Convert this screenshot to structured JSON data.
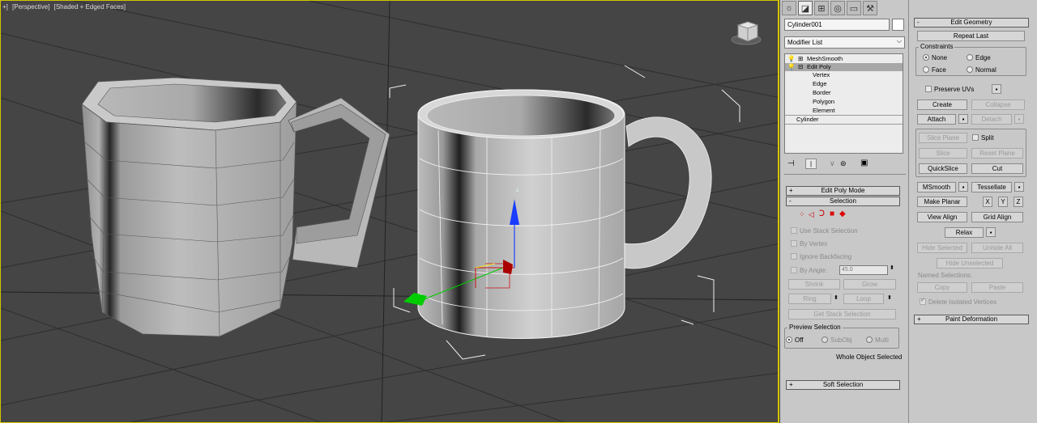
{
  "viewport": {
    "labels": [
      "+]",
      "[Perspective]",
      "[Shaded + Edged Faces]"
    ]
  },
  "command_panel": {
    "object_name": "Cylinder001",
    "modifier_list": "Modifier List",
    "stack": {
      "items": [
        {
          "label": "MeshSmooth",
          "indent": 0,
          "selected": false
        },
        {
          "label": "Edit Poly",
          "indent": 0,
          "selected": true
        },
        {
          "label": "Vertex",
          "indent": 1,
          "selected": false
        },
        {
          "label": "Edge",
          "indent": 1,
          "selected": false
        },
        {
          "label": "Border",
          "indent": 1,
          "selected": false
        },
        {
          "label": "Polygon",
          "indent": 1,
          "selected": false
        },
        {
          "label": "Element",
          "indent": 1,
          "selected": false
        },
        {
          "label": "Cylinder",
          "indent": 0,
          "selected": false
        }
      ]
    },
    "edit_poly_mode": "Edit Poly Mode",
    "selection": {
      "title": "Selection",
      "use_stack_selection": "Use Stack Selection",
      "by_vertex": "By Vertex",
      "ignore_backfacing": "Ignore Backfacing",
      "by_angle": "By Angle:",
      "angle_value": "45.0",
      "shrink": "Shrink",
      "grow": "Grow",
      "ring": "Ring",
      "loop": "Loop",
      "get_stack_selection": "Get Stack Selection",
      "preview_selection": "Preview Selection",
      "off": "Off",
      "subobj": "SubObj",
      "multi": "Multi",
      "status": "Whole Object Selected"
    },
    "soft_selection": "Soft Selection"
  },
  "edit_geometry": {
    "title": "Edit Geometry",
    "repeat_last": "Repeat Last",
    "constraints": "Constraints",
    "none": "None",
    "edge": "Edge",
    "face": "Face",
    "normal": "Normal",
    "preserve_uvs": "Preserve UVs",
    "create": "Create",
    "collapse": "Collapse",
    "attach": "Attach",
    "detach": "Detach",
    "slice_plane": "Slice Plane",
    "split": "Split",
    "slice": "Slice",
    "reset_plane": "Reset Plane",
    "quickslice": "QuickSlice",
    "cut": "Cut",
    "msmooth": "MSmooth",
    "tessellate": "Tessellate",
    "make_planar": "Make Planar",
    "x": "X",
    "y": "Y",
    "z": "Z",
    "view_align": "View Align",
    "grid_align": "Grid Align",
    "relax": "Relax",
    "hide_selected": "Hide Selected",
    "unhide_all": "Unhide All",
    "hide_unselected": "Hide Unselected",
    "named_selections": "Named Selections:",
    "copy": "Copy",
    "paste": "Paste",
    "delete_isolated": "Delete Isolated Vertices",
    "paint_deformation": "Paint Deformation"
  },
  "colors": {
    "viewport_bg": "#454545",
    "active_border": "#d4c400",
    "panel_bg": "#c8c8c8",
    "gizmo_z": "#1a3cff",
    "gizmo_y": "#00cc00",
    "gizmo_x": "#cc0000"
  }
}
